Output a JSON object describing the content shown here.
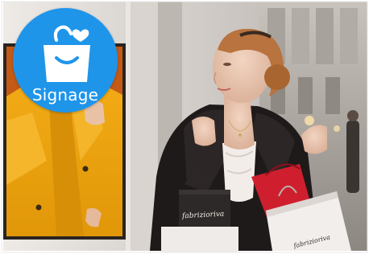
{
  "badge": {
    "label": "Signage",
    "icon": "shopping-bag-icon",
    "color": "#1f95ea"
  },
  "bag_brand_front": "fabrizioriva",
  "bag_brand_right": "fabrizioriva"
}
